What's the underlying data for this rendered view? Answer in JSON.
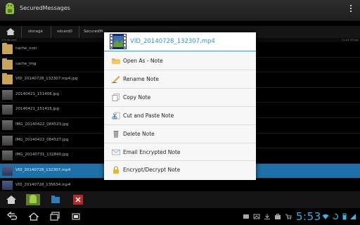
{
  "app": {
    "title": "SecuredMessages"
  },
  "path": {
    "crumbs": [
      "storage",
      "sdcard0",
      "SecuredM"
    ],
    "info_left": "478.0b used",
    "info_right": "11:42 05 Nov"
  },
  "files": [
    {
      "name": "cache_icon",
      "kind": "folder"
    },
    {
      "name": "cache_img",
      "kind": "folder"
    },
    {
      "name": "VID_20140728_132307.mp4.jpg",
      "kind": "folder"
    },
    {
      "name": "20140421_151406.jpg",
      "kind": "img"
    },
    {
      "name": "20140421_151416.jpg",
      "kind": "img"
    },
    {
      "name": "IMG_20140422_084523.jpg",
      "kind": "img"
    },
    {
      "name": "IMG_20140422_084527.jpg",
      "kind": "img"
    },
    {
      "name": "IMG_20140731_132840.jpg",
      "kind": "img"
    },
    {
      "name": "VID_20140728_132307.mp4",
      "kind": "vid",
      "selected": true
    },
    {
      "name": "VID_20140728_135634.mp4",
      "kind": "vid"
    }
  ],
  "menu": {
    "title": "VID_20140728_132307.mp4",
    "items": [
      {
        "label": "Open As - Note",
        "icon": "folder-icon"
      },
      {
        "label": "Rename Note",
        "icon": "pencil-icon"
      },
      {
        "label": "Copy Note",
        "icon": "copy-icon"
      },
      {
        "label": "Cut and Paste Note",
        "icon": "cut-paste-icon"
      },
      {
        "label": "Delete Note",
        "icon": "trash-icon"
      },
      {
        "label": "Email Encrypted Note",
        "icon": "envelope-icon"
      },
      {
        "label": "Encrypt/Decrypt Note",
        "icon": "lock-icon"
      }
    ]
  },
  "status": {
    "time": "5:53"
  },
  "colors": {
    "accent": "#33b5e5",
    "selected_row": "#1f6fa8"
  }
}
